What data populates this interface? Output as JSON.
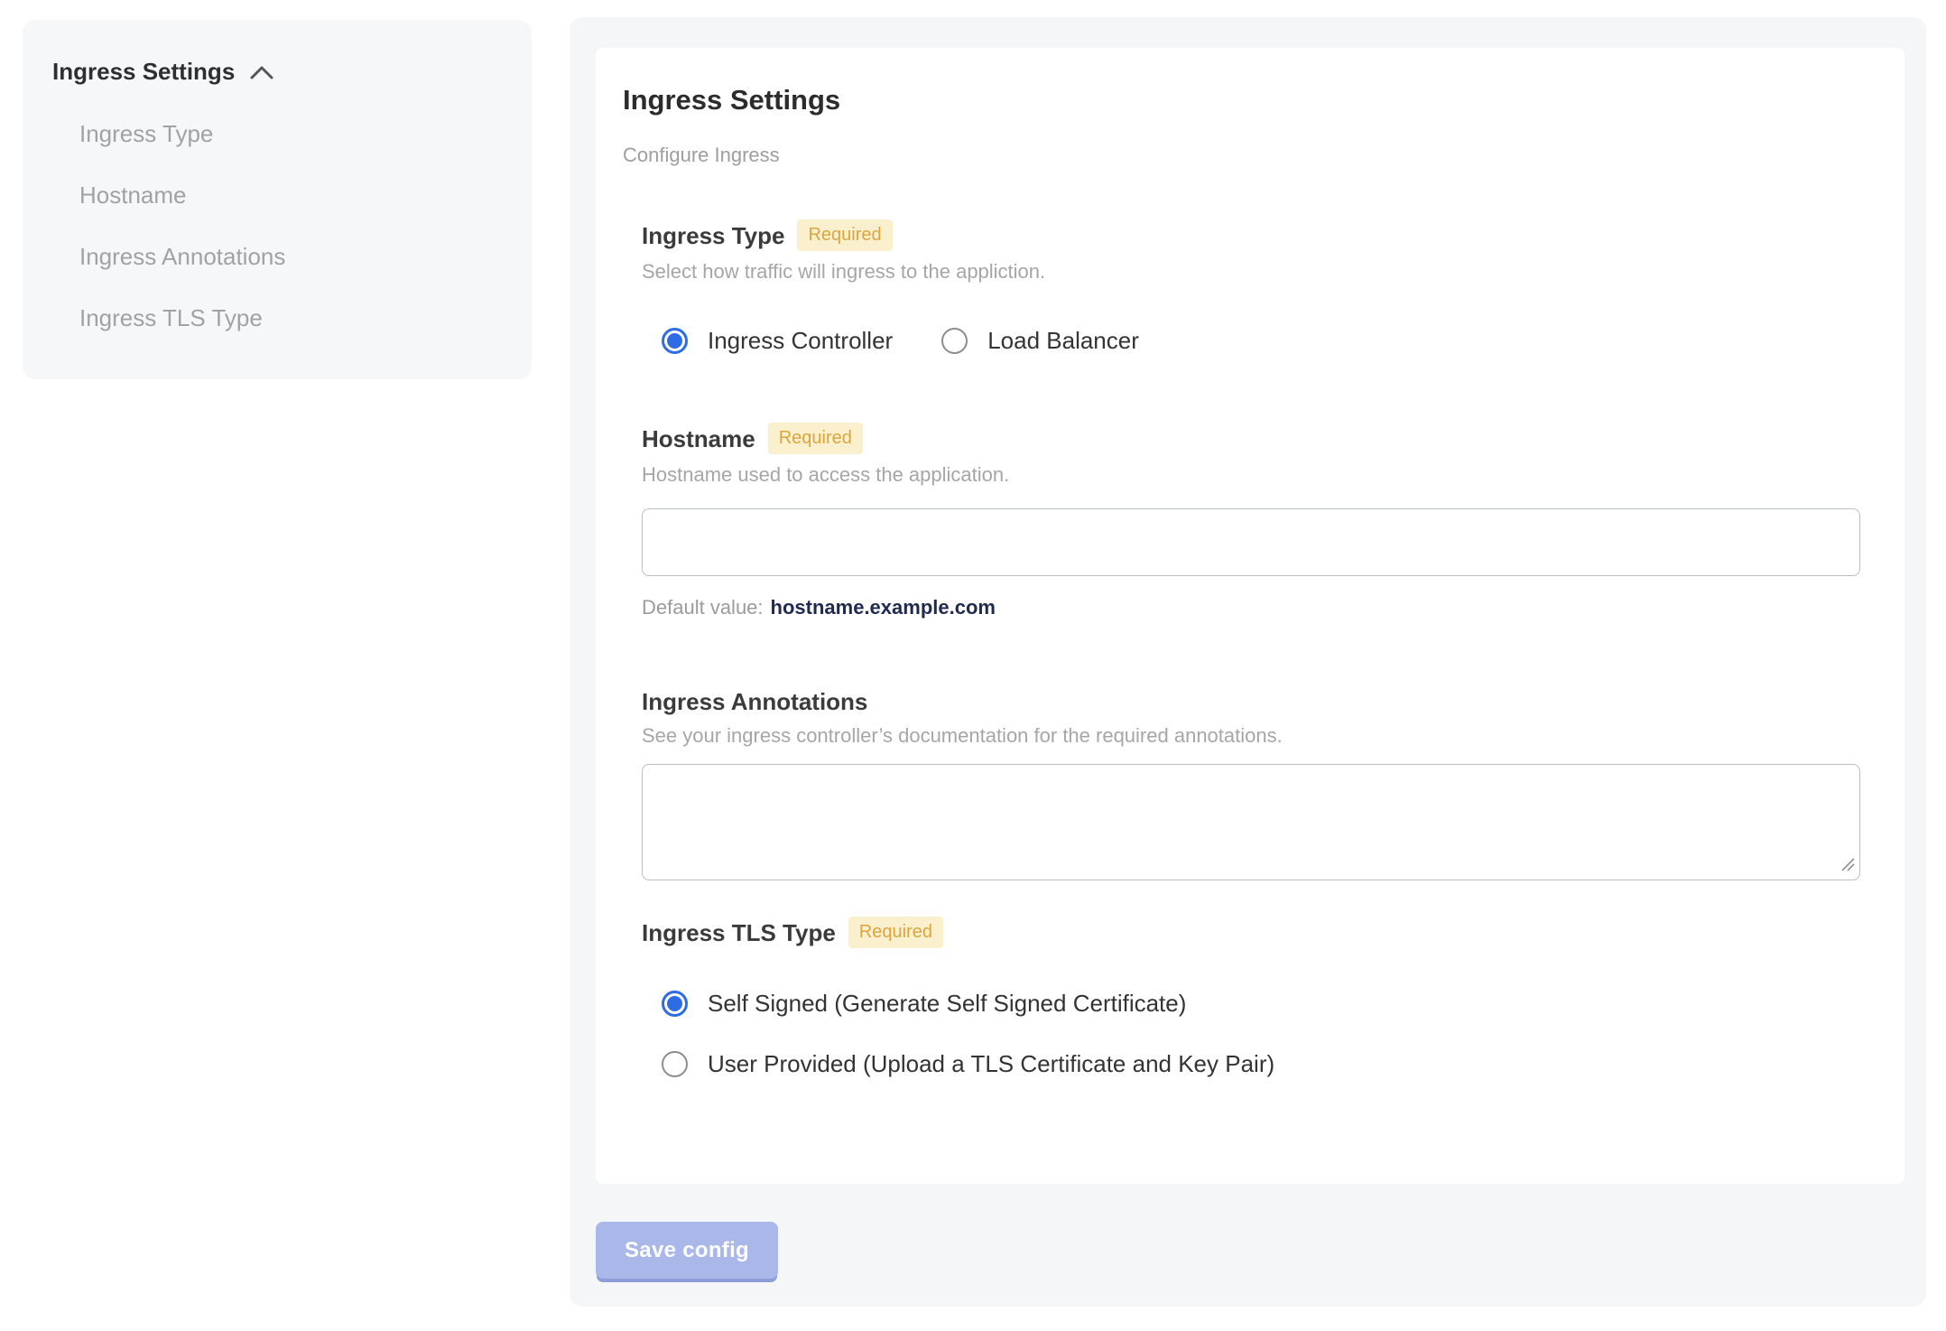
{
  "sidebar": {
    "group": {
      "label": "Ingress Settings",
      "collapse_icon": "chevron-up-icon"
    },
    "items": [
      {
        "label": "Ingress Type"
      },
      {
        "label": "Hostname"
      },
      {
        "label": "Ingress Annotations"
      },
      {
        "label": "Ingress TLS Type"
      }
    ]
  },
  "main": {
    "title": "Ingress Settings",
    "subtitle": "Configure Ingress",
    "required_badge": "Required",
    "sections": {
      "ingress_type": {
        "label": "Ingress Type",
        "required": true,
        "description": "Select how traffic will ingress to the appliction.",
        "options": [
          {
            "label": "Ingress Controller",
            "selected": true
          },
          {
            "label": "Load Balancer",
            "selected": false
          }
        ]
      },
      "hostname": {
        "label": "Hostname",
        "required": true,
        "description": "Hostname used to access the application.",
        "input_value": "",
        "default_label": "Default value:",
        "default_value": "hostname.example.com"
      },
      "annotations": {
        "label": "Ingress Annotations",
        "required": false,
        "description": "See your ingress controller’s documentation for the required annotations.",
        "textarea_value": ""
      },
      "tls_type": {
        "label": "Ingress TLS Type",
        "required": true,
        "options": [
          {
            "label": "Self Signed (Generate Self Signed Certificate)",
            "selected": true
          },
          {
            "label": "User Provided (Upload a TLS Certificate and Key Pair)",
            "selected": false
          }
        ]
      }
    },
    "save_button": "Save config"
  },
  "colors": {
    "accent_blue": "#2e6ce5",
    "badge_text": "#dca53e",
    "badge_bg": "#fbf0cd",
    "save_button_bg": "#a9b7e9",
    "save_button_shadow": "#8d9ed6",
    "default_value_text": "#1e2a4e",
    "panel_bg": "#f4f6f8",
    "sidebar_bg": "#f6f7f9",
    "input_border": "#b9bfc7"
  }
}
